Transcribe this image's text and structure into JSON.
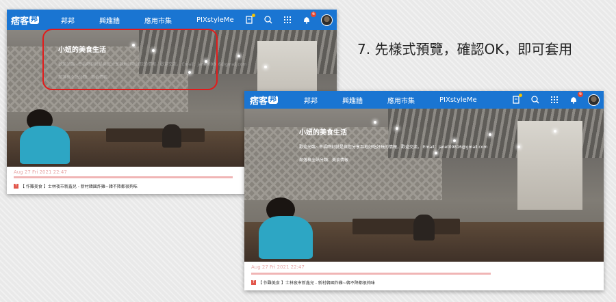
{
  "caption": "7. 先樣式預覽，確認OK，即可套用",
  "logo": {
    "text": "痞客",
    "badge": "邦"
  },
  "nav": [
    "邦邦",
    "興趣牆",
    "應用市集",
    "PIXstyleMe"
  ],
  "notification_count": "6",
  "blog": {
    "title": "小妞的美食生活",
    "description": "歡迎光臨~幸福時刻就是與您分享吞地好吃好玩的情報，歡迎交流。 Email：janet09816@gmail.com",
    "category": "部落格全站分類：美食情報",
    "date": "Aug 27 Fri 2021 22:47",
    "post_icon": "T",
    "post_title": "【 作難美食 】士林夜市新鑫兒 - 新村韓國炸雞~韓不降都很夠味"
  },
  "icons": [
    "article-icon",
    "search-zoom-icon",
    "grid-icon",
    "bell-icon",
    "avatar"
  ],
  "colors": {
    "nav_bg": "#1a75d2",
    "highlight": "#e21b1b",
    "accent_pink": "#f0b5b5"
  }
}
